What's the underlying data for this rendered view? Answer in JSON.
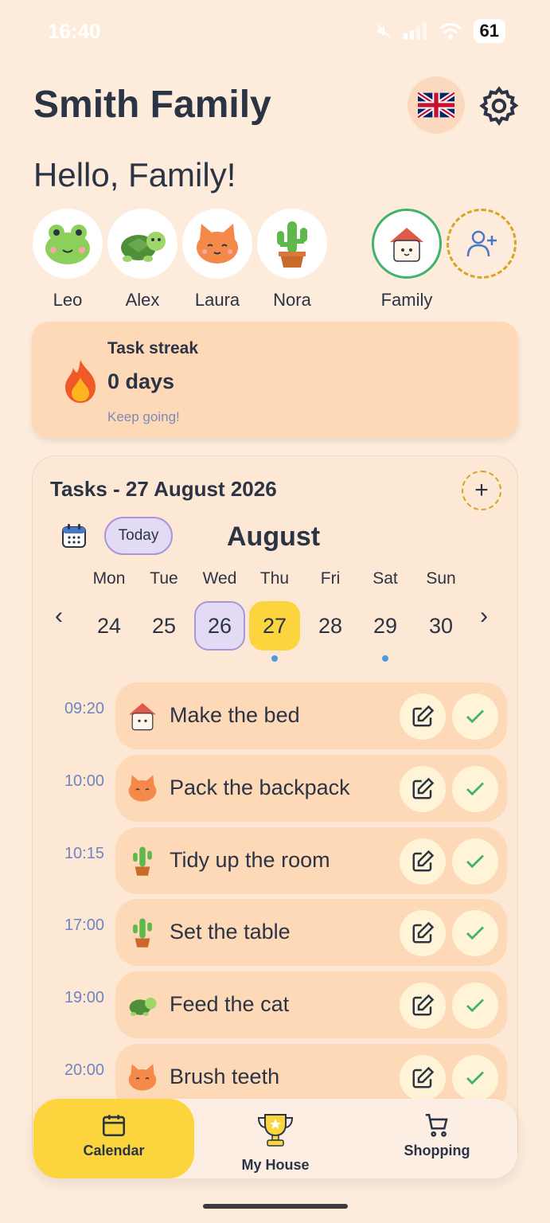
{
  "status_bar": {
    "time": "16:40",
    "battery": "61"
  },
  "header": {
    "title": "Smith Family",
    "greeting": "Hello, Family!"
  },
  "members": [
    {
      "name": "Leo",
      "avatar": "frog-icon"
    },
    {
      "name": "Alex",
      "avatar": "turtle-icon"
    },
    {
      "name": "Laura",
      "avatar": "cat-icon"
    },
    {
      "name": "Nora",
      "avatar": "cactus-icon"
    },
    {
      "name": "Family",
      "avatar": "house-icon"
    }
  ],
  "streak": {
    "label": "Task streak",
    "days": "0 days",
    "note": "Keep going!"
  },
  "tasks": {
    "title": "Tasks - 27 August 2026",
    "today_label": "Today",
    "month": "August",
    "weekdays": [
      "Mon",
      "Tue",
      "Wed",
      "Thu",
      "Fri",
      "Sat",
      "Sun"
    ],
    "dates": [
      "24",
      "25",
      "26",
      "27",
      "28",
      "29",
      "30"
    ],
    "items": [
      {
        "time": "09:20",
        "label": "Make the bed",
        "icon": "house-icon"
      },
      {
        "time": "10:00",
        "label": "Pack the backpack",
        "icon": "cat-icon"
      },
      {
        "time": "10:15",
        "label": "Tidy up the room",
        "icon": "cactus-icon"
      },
      {
        "time": "17:00",
        "label": "Set the table",
        "icon": "cactus-icon"
      },
      {
        "time": "19:00",
        "label": "Feed the cat",
        "icon": "turtle-icon"
      },
      {
        "time": "20:00",
        "label": "Brush teeth",
        "icon": "cat-icon"
      }
    ]
  },
  "nav": {
    "calendar": "Calendar",
    "house": "My House",
    "shopping": "Shopping"
  },
  "colors": {
    "background": "#fdebdc",
    "accent": "#fcd43d",
    "selected": "#e3dbf5",
    "done": "#3fb36a"
  }
}
